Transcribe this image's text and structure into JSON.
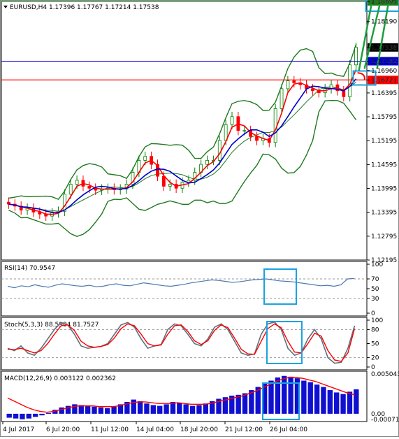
{
  "header": {
    "symbol_line": "EURUSD,H4  1.17396 1.17767 1.17214 1.17538"
  },
  "price_axis": {
    "ticks": [
      "1.18695",
      "1.18190",
      "1.17538",
      "1.17192",
      "1.16960",
      "1.16721",
      "1.16395",
      "1.15795",
      "1.15195",
      "1.14595",
      "1.13995",
      "1.13395",
      "1.12795",
      "1.12195"
    ]
  },
  "levels": {
    "top_line": "1.18695",
    "current": "1.17538",
    "blue_line": "1.17192",
    "red_line": "1.16721"
  },
  "rsi": {
    "label": "RSI(14) 70.9547",
    "ticks": [
      "100",
      "70",
      "50",
      "30",
      "0"
    ]
  },
  "stoch": {
    "label": "Stoch(5,3,3) 88.5904 81.7527",
    "ticks": [
      "100",
      "80",
      "50",
      "20",
      "0"
    ]
  },
  "macd": {
    "label": "MACD(12,26,9) 0.003122 0.002362",
    "ticks": [
      "0.005043",
      "0.00",
      "-0.000718"
    ]
  },
  "time_axis": {
    "labels": [
      "4 Jul 2017",
      "6 Jul 20:00",
      "11 Jul 12:00",
      "14 Jul 04:00",
      "18 Jul 20:00",
      "21 Jul 12:00",
      "26 Jul 04:00"
    ]
  },
  "colors": {
    "bull_candle": "#008000",
    "bear_candle": "#ff0000",
    "bollinger": "#1e7a1e",
    "ma_fast": "#ff0000",
    "ma_slow": "#0000cc",
    "rsi_line": "#4a7ab0",
    "stoch_main": "#607080",
    "stoch_signal": "#ff0000",
    "macd_hist": "#1010d0",
    "macd_signal": "#ff0000",
    "highlight_box": "#1aa3e0",
    "top_line": "#1e7a1e",
    "blue_line": "#0000cc",
    "red_line": "#ff0000"
  },
  "chart_data": [
    {
      "type": "candlestick",
      "title": "EURUSD,H4",
      "ohlc_last": {
        "open": 1.17396,
        "high": 1.17767,
        "low": 1.17214,
        "close": 1.17538
      },
      "closes": [
        1.136,
        1.1355,
        1.1345,
        1.135,
        1.134,
        1.1335,
        1.133,
        1.1338,
        1.1342,
        1.1385,
        1.141,
        1.142,
        1.1405,
        1.14,
        1.1395,
        1.1398,
        1.14,
        1.1396,
        1.1398,
        1.141,
        1.144,
        1.147,
        1.148,
        1.146,
        1.143,
        1.1405,
        1.141,
        1.14,
        1.1415,
        1.142,
        1.144,
        1.146,
        1.147,
        1.147,
        1.152,
        1.156,
        1.158,
        1.1545,
        1.1545,
        1.153,
        1.152,
        1.1525,
        1.1515,
        1.16,
        1.165,
        1.167,
        1.1665,
        1.166,
        1.165,
        1.1645,
        1.164,
        1.165,
        1.166,
        1.1645,
        1.163,
        1.171,
        1.1754
      ],
      "ylim": [
        1.12195,
        1.18695
      ],
      "series": [
        {
          "name": "Bollinger Bands"
        },
        {
          "name": "MA fast"
        },
        {
          "name": "MA slow"
        }
      ],
      "horizontal_levels": [
        1.18695,
        1.17192,
        1.16721
      ]
    },
    {
      "type": "line",
      "title": "RSI(14) 70.9547",
      "ylim": [
        0,
        100
      ],
      "values": [
        55,
        52,
        56,
        54,
        58,
        55,
        53,
        57,
        60,
        58,
        56,
        55,
        57,
        54,
        55,
        58,
        60,
        57,
        56,
        59,
        62,
        60,
        58,
        56,
        55,
        57,
        59,
        62,
        64,
        66,
        68,
        67,
        65,
        63,
        64,
        66,
        68,
        69,
        70,
        68,
        66,
        65,
        64,
        62,
        60,
        58,
        56,
        57,
        55,
        58,
        70,
        71
      ]
    },
    {
      "type": "line",
      "title": "Stoch(5,3,3) 88.5904 81.7527",
      "ylim": [
        0,
        100
      ],
      "series": [
        {
          "name": "main",
          "values": [
            40,
            35,
            45,
            30,
            25,
            40,
            60,
            80,
            95,
            90,
            70,
            45,
            40,
            42,
            44,
            50,
            70,
            90,
            95,
            85,
            60,
            40,
            45,
            48,
            80,
            92,
            88,
            70,
            50,
            45,
            60,
            85,
            92,
            80,
            55,
            30,
            25,
            28,
            70,
            92,
            96,
            80,
            40,
            25,
            30,
            60,
            80,
            60,
            20,
            8,
            10,
            40,
            88
          ]
        },
        {
          "name": "signal",
          "values": [
            38,
            37,
            40,
            35,
            30,
            35,
            50,
            70,
            88,
            90,
            78,
            55,
            45,
            42,
            44,
            48,
            62,
            82,
            92,
            88,
            70,
            50,
            45,
            47,
            70,
            88,
            90,
            76,
            56,
            48,
            56,
            78,
            90,
            84,
            62,
            38,
            28,
            27,
            55,
            82,
            92,
            84,
            55,
            32,
            30,
            50,
            72,
            66,
            35,
            15,
            12,
            30,
            82
          ]
        }
      ]
    },
    {
      "type": "bar",
      "title": "MACD(12,26,9) 0.003122 0.002362",
      "ylim": [
        -0.000718,
        0.005043
      ],
      "values": [
        -0.0005,
        -0.0006,
        -0.0007,
        -0.0006,
        -0.0004,
        -0.0002,
        0.0001,
        0.0005,
        0.0008,
        0.001,
        0.0012,
        0.0011,
        0.001,
        0.0009,
        0.0008,
        0.0007,
        0.0009,
        0.0012,
        0.0015,
        0.0018,
        0.0016,
        0.0013,
        0.0011,
        0.001,
        0.0012,
        0.0015,
        0.0014,
        0.0012,
        0.001,
        0.0011,
        0.0013,
        0.0016,
        0.0019,
        0.0021,
        0.0023,
        0.0024,
        0.0026,
        0.003,
        0.0034,
        0.0038,
        0.0042,
        0.0046,
        0.0048,
        0.0047,
        0.0045,
        0.0042,
        0.004,
        0.0037,
        0.0034,
        0.003,
        0.0027,
        0.0025,
        0.0028,
        0.0031
      ],
      "signal": [
        0.002,
        0.0016,
        0.0012,
        0.0008,
        0.0005,
        0.0003,
        0.0002,
        0.0003,
        0.0005,
        0.0007,
        0.0009,
        0.001,
        0.001,
        0.001,
        0.0009,
        0.0009,
        0.0009,
        0.001,
        0.0012,
        0.0014,
        0.0015,
        0.0015,
        0.0014,
        0.0013,
        0.0013,
        0.0013,
        0.0014,
        0.0013,
        0.0012,
        0.0012,
        0.0012,
        0.0013,
        0.0015,
        0.0017,
        0.0019,
        0.0021,
        0.0023,
        0.0026,
        0.0029,
        0.0033,
        0.0037,
        0.0041,
        0.0044,
        0.0046,
        0.0046,
        0.0045,
        0.0043,
        0.0041,
        0.0038,
        0.0035,
        0.0032,
        0.0029,
        0.0026,
        0.0024
      ]
    }
  ]
}
